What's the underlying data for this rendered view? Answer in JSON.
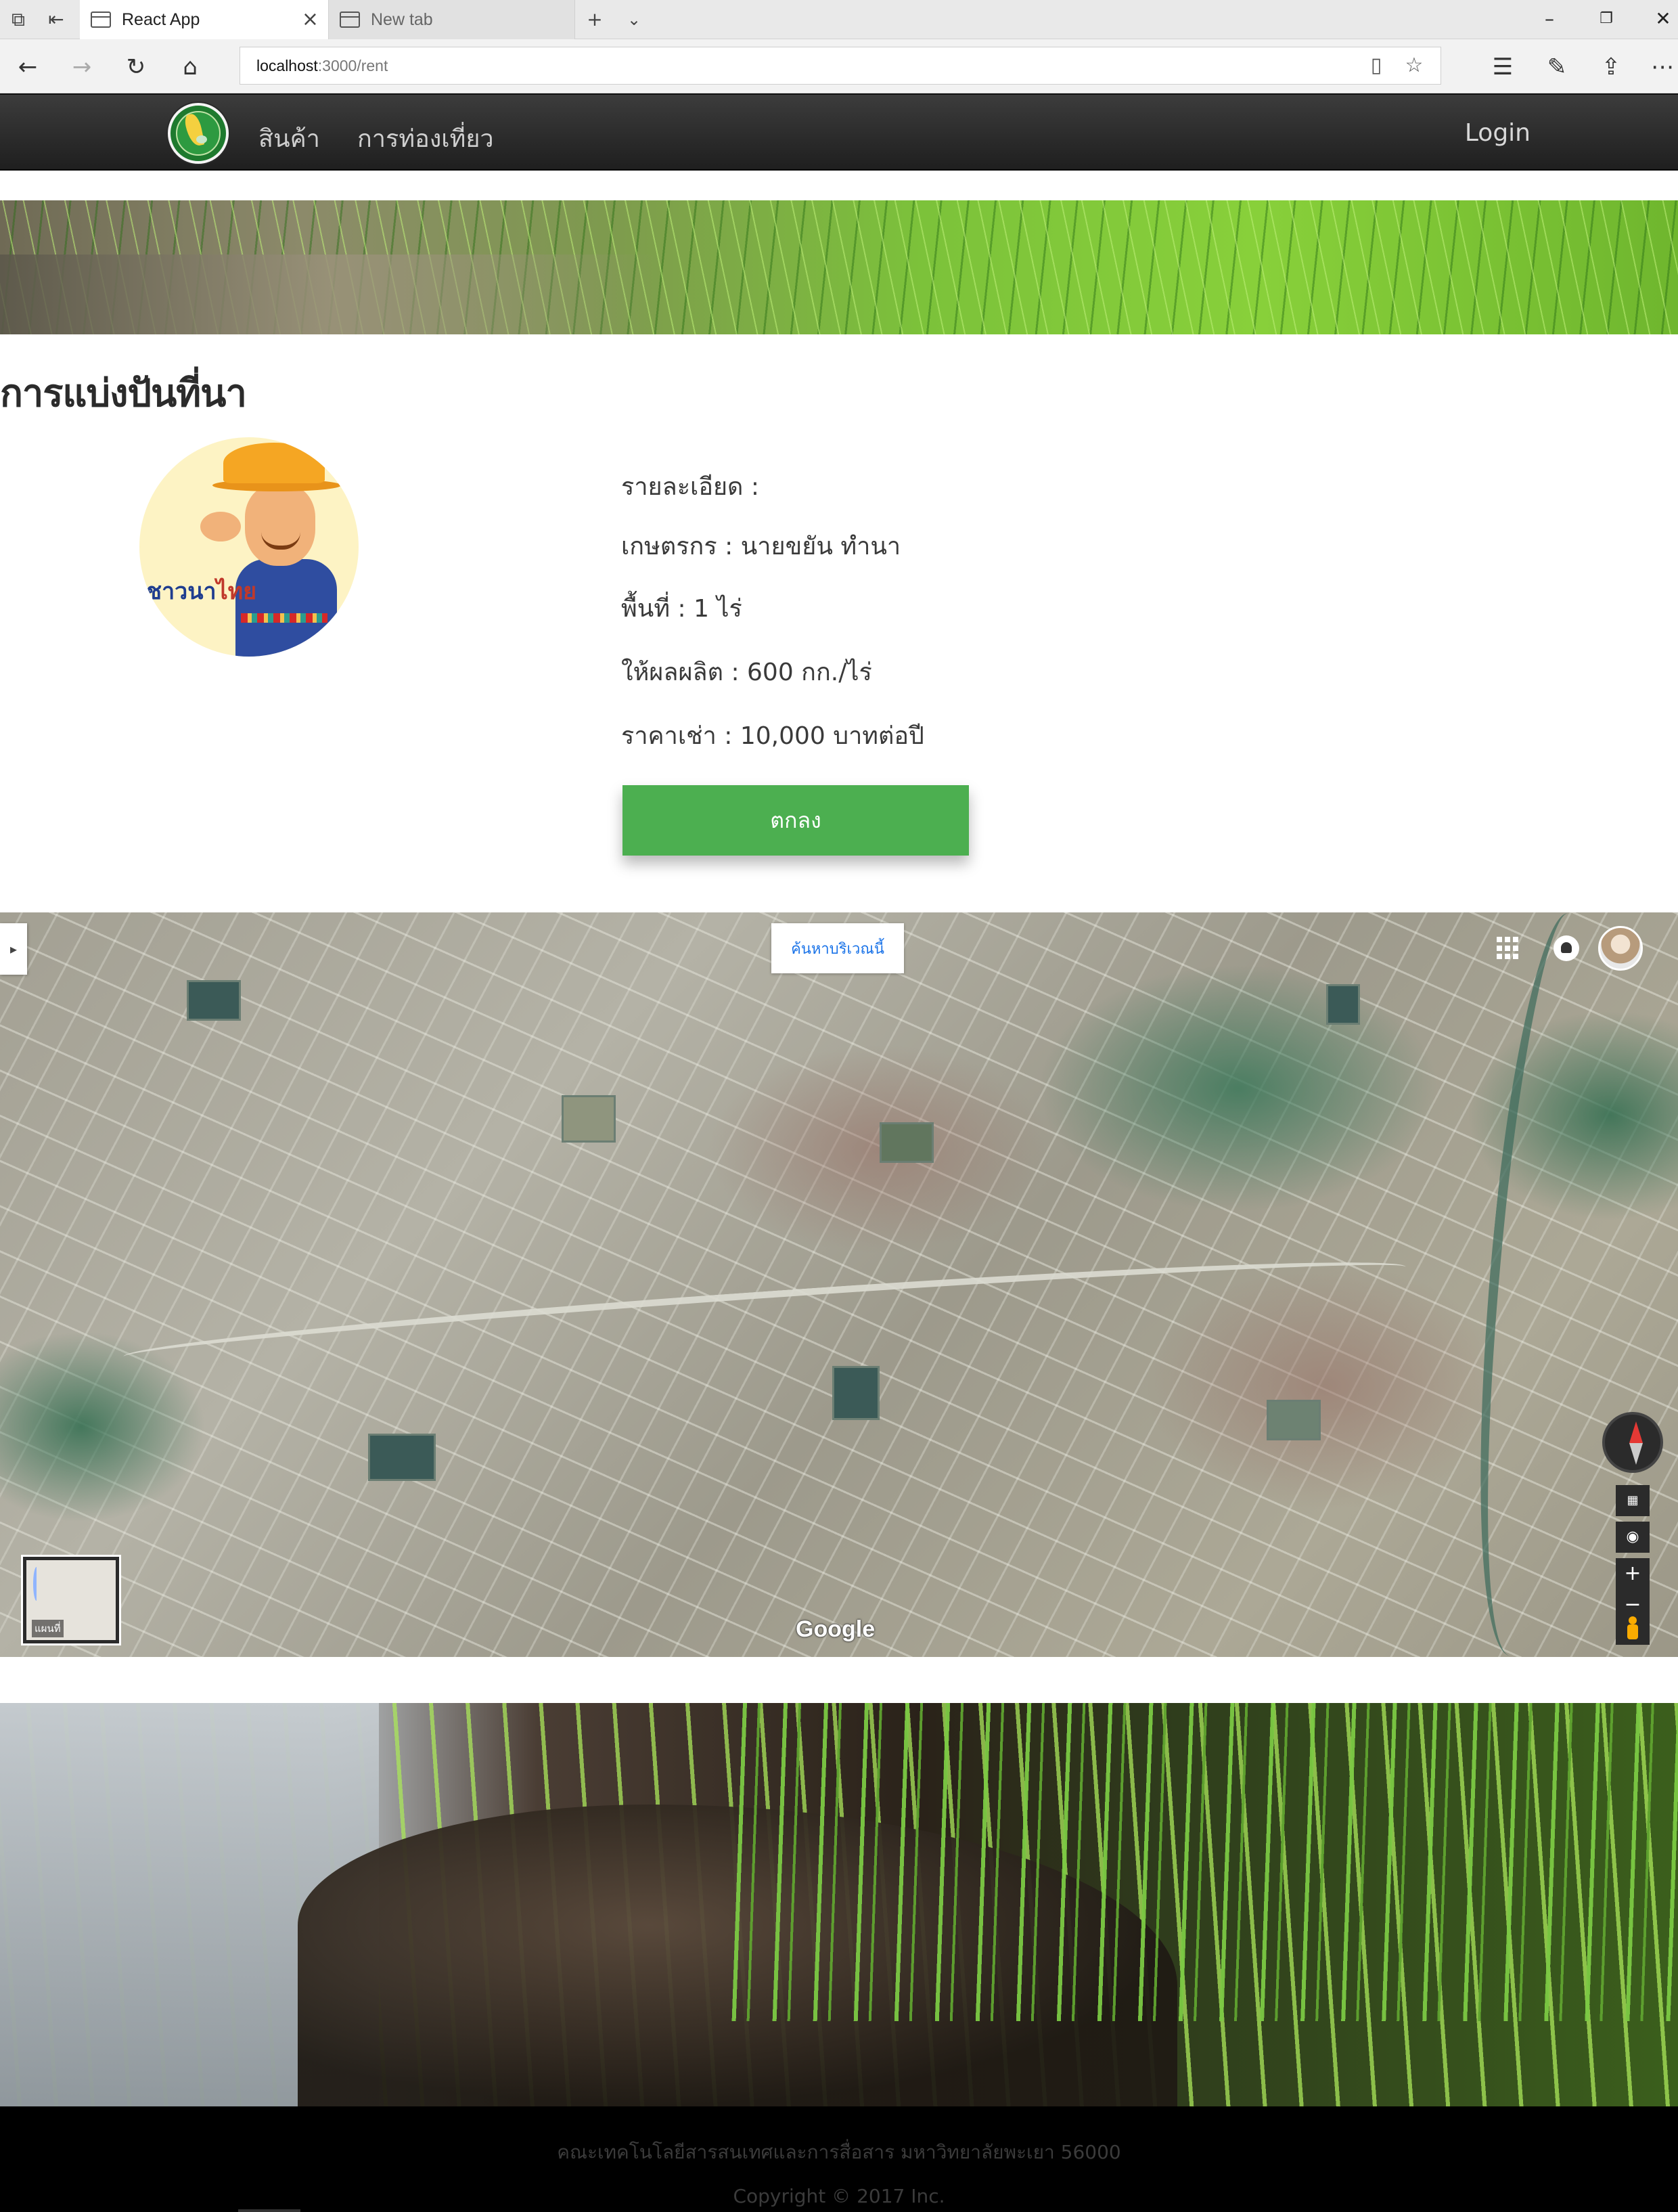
{
  "browser": {
    "tabs": [
      {
        "title": "React App",
        "active": true
      },
      {
        "title": "New tab",
        "active": false
      }
    ],
    "url_host": "localhost",
    "url_rest": ":3000/rent",
    "new_tab_symbol": "+",
    "close_symbol": "×",
    "icons": [
      "tab-actions-icon",
      "back-icon",
      "forward-icon",
      "refresh-icon",
      "home-icon",
      "reading-view-icon",
      "favorite-star-icon",
      "favorites-list-icon",
      "pen-icon",
      "share-icon",
      "more-icon"
    ],
    "window_controls": {
      "minimize": "–",
      "restore": "❐",
      "close": "✕"
    }
  },
  "nav": {
    "items": [
      {
        "label": "สินค้า"
      },
      {
        "label": "การท่องเที่ยว"
      }
    ],
    "login": "Login"
  },
  "page": {
    "title": "การแบ่งปันที่นา"
  },
  "avatar": {
    "brand_a": "ชาวนา",
    "brand_b": "ไทย"
  },
  "details": {
    "heading": "รายละเอียด :",
    "farmer": "เกษตรกร : นายขยัน ทำนา",
    "area": "พื้นที่ : 1 ไร่",
    "yield": "ให้ผลผลิต : 600 กก./ไร่",
    "price": "ราคาเช่า : 10,000 บาทต่อปี"
  },
  "button": {
    "label": "ตกลง",
    "color": "#4caf50"
  },
  "map": {
    "search_area": "ค้นหาบริเวณนี้",
    "zoom_in": "+",
    "zoom_out": "−",
    "minimap_label": "แผนที่",
    "attribution": "Google"
  },
  "footer": {
    "line1": "คณะเทคโนโลยีสารสนเทศและการสื่อสาร มหาวิทยาลัยพะเยา 56000",
    "line2": "Copyright © 2017 Inc."
  }
}
